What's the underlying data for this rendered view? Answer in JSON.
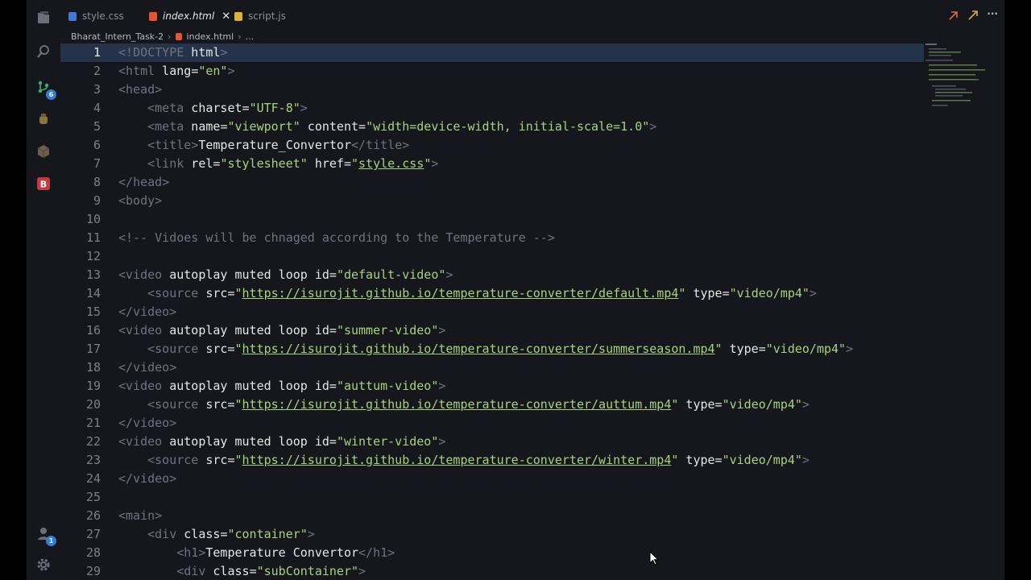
{
  "tabs": [
    {
      "label": "style.css",
      "icon": "css-file-icon"
    },
    {
      "label": "index.html",
      "icon": "html-file-icon",
      "active": true
    },
    {
      "label": "script.js",
      "icon": "js-file-icon"
    }
  ],
  "breadcrumb": [
    "Bharat_Intern_Task-2",
    "index.html",
    "..."
  ],
  "badges": {
    "source_control": "6",
    "accounts": "1"
  },
  "colors": {
    "tag": "#6f7381",
    "attr": "#e6e6e6",
    "string": "#a8d37e",
    "line_highlight": "#24324a",
    "accent": "#2f7fd8"
  },
  "current_line": 1,
  "lines": [
    {
      "n": "1",
      "t": [
        [
          "tb",
          "<!"
        ],
        [
          "tn",
          "DOCTYPE"
        ],
        [
          "at",
          " html"
        ],
        [
          "tb",
          ">"
        ]
      ]
    },
    {
      "n": "2",
      "t": [
        [
          "tb",
          "<"
        ],
        [
          "tn",
          "html"
        ],
        [
          "at",
          " lang"
        ],
        [
          "tx",
          "="
        ],
        [
          "st",
          "\"en\""
        ],
        [
          "tb",
          ">"
        ]
      ]
    },
    {
      "n": "3",
      "t": [
        [
          "tb",
          "<"
        ],
        [
          "tn",
          "head"
        ],
        [
          "tb",
          ">"
        ]
      ]
    },
    {
      "n": "4",
      "t": [
        [
          "tx",
          "    "
        ],
        [
          "tb",
          "<"
        ],
        [
          "tn",
          "meta"
        ],
        [
          "at",
          " charset"
        ],
        [
          "tx",
          "="
        ],
        [
          "st",
          "\"UTF-8\""
        ],
        [
          "tb",
          ">"
        ]
      ]
    },
    {
      "n": "5",
      "t": [
        [
          "tx",
          "    "
        ],
        [
          "tb",
          "<"
        ],
        [
          "tn",
          "meta"
        ],
        [
          "at",
          " name"
        ],
        [
          "tx",
          "="
        ],
        [
          "st",
          "\"viewport\""
        ],
        [
          "at",
          " content"
        ],
        [
          "tx",
          "="
        ],
        [
          "st",
          "\"width=device-width, initial-scale=1.0\""
        ],
        [
          "tb",
          ">"
        ]
      ]
    },
    {
      "n": "6",
      "t": [
        [
          "tx",
          "    "
        ],
        [
          "tb",
          "<"
        ],
        [
          "tn",
          "title"
        ],
        [
          "tb",
          ">"
        ],
        [
          "tx",
          "Temperature_Convertor"
        ],
        [
          "tb",
          "</"
        ],
        [
          "tn",
          "title"
        ],
        [
          "tb",
          ">"
        ]
      ]
    },
    {
      "n": "7",
      "t": [
        [
          "tx",
          "    "
        ],
        [
          "tb",
          "<"
        ],
        [
          "tn",
          "link"
        ],
        [
          "at",
          " rel"
        ],
        [
          "tx",
          "="
        ],
        [
          "st",
          "\"stylesheet\""
        ],
        [
          "at",
          " href"
        ],
        [
          "tx",
          "="
        ],
        [
          "st",
          "\""
        ],
        [
          "lk",
          "style.css"
        ],
        [
          "st",
          "\""
        ],
        [
          "tb",
          ">"
        ]
      ]
    },
    {
      "n": "8",
      "t": [
        [
          "tb",
          "</"
        ],
        [
          "tn",
          "head"
        ],
        [
          "tb",
          ">"
        ]
      ]
    },
    {
      "n": "9",
      "t": [
        [
          "tb",
          "<"
        ],
        [
          "tn",
          "body"
        ],
        [
          "tb",
          ">"
        ]
      ]
    },
    {
      "n": "10",
      "t": []
    },
    {
      "n": "11",
      "t": [
        [
          "cm",
          "<!-- Vidoes will be chnaged according to the Temperature -->"
        ]
      ]
    },
    {
      "n": "12",
      "t": []
    },
    {
      "n": "13",
      "t": [
        [
          "tb",
          "<"
        ],
        [
          "tn",
          "video"
        ],
        [
          "at",
          " autoplay muted loop id"
        ],
        [
          "tx",
          "="
        ],
        [
          "st",
          "\"default-video\""
        ],
        [
          "tb",
          ">"
        ]
      ]
    },
    {
      "n": "14",
      "t": [
        [
          "tx",
          "    "
        ],
        [
          "tb",
          "<"
        ],
        [
          "tn",
          "source"
        ],
        [
          "at",
          " src"
        ],
        [
          "tx",
          "="
        ],
        [
          "st",
          "\""
        ],
        [
          "lk",
          "https://isurojit.github.io/temperature-converter/default.mp4"
        ],
        [
          "st",
          "\""
        ],
        [
          "at",
          " type"
        ],
        [
          "tx",
          "="
        ],
        [
          "st",
          "\"video/mp4\""
        ],
        [
          "tb",
          ">"
        ]
      ]
    },
    {
      "n": "15",
      "t": [
        [
          "tb",
          "</"
        ],
        [
          "tn",
          "video"
        ],
        [
          "tb",
          ">"
        ]
      ]
    },
    {
      "n": "16",
      "t": [
        [
          "tb",
          "<"
        ],
        [
          "tn",
          "video"
        ],
        [
          "at",
          " autoplay muted loop id"
        ],
        [
          "tx",
          "="
        ],
        [
          "st",
          "\"summer-video\""
        ],
        [
          "tb",
          ">"
        ]
      ]
    },
    {
      "n": "17",
      "t": [
        [
          "tx",
          "    "
        ],
        [
          "tb",
          "<"
        ],
        [
          "tn",
          "source"
        ],
        [
          "at",
          " src"
        ],
        [
          "tx",
          "="
        ],
        [
          "st",
          "\""
        ],
        [
          "lk",
          "https://isurojit.github.io/temperature-converter/summerseason.mp4"
        ],
        [
          "st",
          "\""
        ],
        [
          "at",
          " type"
        ],
        [
          "tx",
          "="
        ],
        [
          "st",
          "\"video/mp4\""
        ],
        [
          "tb",
          ">"
        ]
      ]
    },
    {
      "n": "18",
      "t": [
        [
          "tb",
          "</"
        ],
        [
          "tn",
          "video"
        ],
        [
          "tb",
          ">"
        ]
      ]
    },
    {
      "n": "19",
      "t": [
        [
          "tb",
          "<"
        ],
        [
          "tn",
          "video"
        ],
        [
          "at",
          " autoplay muted loop id"
        ],
        [
          "tx",
          "="
        ],
        [
          "st",
          "\"auttum-video\""
        ],
        [
          "tb",
          ">"
        ]
      ]
    },
    {
      "n": "20",
      "t": [
        [
          "tx",
          "    "
        ],
        [
          "tb",
          "<"
        ],
        [
          "tn",
          "source"
        ],
        [
          "at",
          " src"
        ],
        [
          "tx",
          "="
        ],
        [
          "st",
          "\""
        ],
        [
          "lk",
          "https://isurojit.github.io/temperature-converter/auttum.mp4"
        ],
        [
          "st",
          "\""
        ],
        [
          "at",
          " type"
        ],
        [
          "tx",
          "="
        ],
        [
          "st",
          "\"video/mp4\""
        ],
        [
          "tb",
          ">"
        ]
      ]
    },
    {
      "n": "21",
      "t": [
        [
          "tb",
          "</"
        ],
        [
          "tn",
          "video"
        ],
        [
          "tb",
          ">"
        ]
      ]
    },
    {
      "n": "22",
      "t": [
        [
          "tb",
          "<"
        ],
        [
          "tn",
          "video"
        ],
        [
          "at",
          " autoplay muted loop id"
        ],
        [
          "tx",
          "="
        ],
        [
          "st",
          "\"winter-video\""
        ],
        [
          "tb",
          ">"
        ]
      ]
    },
    {
      "n": "23",
      "t": [
        [
          "tx",
          "    "
        ],
        [
          "tb",
          "<"
        ],
        [
          "tn",
          "source"
        ],
        [
          "at",
          " src"
        ],
        [
          "tx",
          "="
        ],
        [
          "st",
          "\""
        ],
        [
          "lk",
          "https://isurojit.github.io/temperature-converter/winter.mp4"
        ],
        [
          "st",
          "\""
        ],
        [
          "at",
          " type"
        ],
        [
          "tx",
          "="
        ],
        [
          "st",
          "\"video/mp4\""
        ],
        [
          "tb",
          ">"
        ]
      ]
    },
    {
      "n": "24",
      "t": [
        [
          "tb",
          "</"
        ],
        [
          "tn",
          "video"
        ],
        [
          "tb",
          ">"
        ]
      ]
    },
    {
      "n": "25",
      "t": []
    },
    {
      "n": "26",
      "t": [
        [
          "tb",
          "<"
        ],
        [
          "tn",
          "main"
        ],
        [
          "tb",
          ">"
        ]
      ]
    },
    {
      "n": "27",
      "t": [
        [
          "tx",
          "    "
        ],
        [
          "tb",
          "<"
        ],
        [
          "tn",
          "div"
        ],
        [
          "at",
          " class"
        ],
        [
          "tx",
          "="
        ],
        [
          "st",
          "\"container\""
        ],
        [
          "tb",
          ">"
        ]
      ]
    },
    {
      "n": "28",
      "t": [
        [
          "tx",
          "        "
        ],
        [
          "tb",
          "<"
        ],
        [
          "tn",
          "h1"
        ],
        [
          "tb",
          ">"
        ],
        [
          "tx",
          "Temperature Convertor"
        ],
        [
          "tb",
          "</"
        ],
        [
          "tn",
          "h1"
        ],
        [
          "tb",
          ">"
        ]
      ]
    },
    {
      "n": "29",
      "t": [
        [
          "tx",
          "        "
        ],
        [
          "tb",
          "<"
        ],
        [
          "tn",
          "div"
        ],
        [
          "at",
          " class"
        ],
        [
          "tx",
          "="
        ],
        [
          "st",
          "\"subContainer\""
        ],
        [
          "tb",
          ">"
        ]
      ]
    }
  ]
}
